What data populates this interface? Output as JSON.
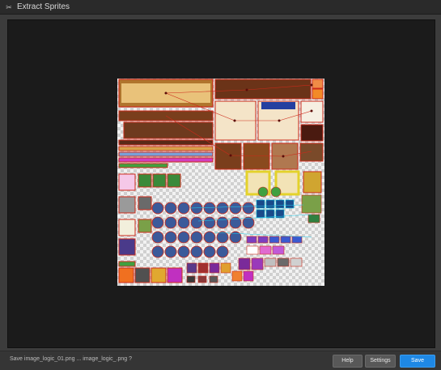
{
  "window": {
    "title": "Extract Sprites",
    "icon": "extract-sprites-icon"
  },
  "footer": {
    "status_text": "Save image_logic_01.png ... image_logic_.png ?",
    "help_label": "Help",
    "settings_label": "Settings",
    "save_label": "Save"
  },
  "colors": {
    "save_accent": "#1e88e5",
    "sprite_outline": "#cc2a1a",
    "sprite_tint": "#7a4a1e"
  }
}
